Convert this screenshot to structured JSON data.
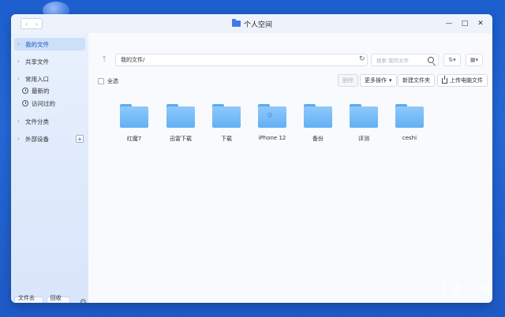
{
  "window": {
    "title": "个人空间",
    "controls": [
      "—",
      "□",
      "✕"
    ]
  },
  "sidebar": {
    "my_files": "我的文件",
    "shared_files": "共享文件",
    "common_entry": "常用入口",
    "recent": "最新的",
    "visited": "访问过的",
    "file_category": "文件分类",
    "external_devices": "外部设备",
    "file_transfer": "文件去重",
    "recycle_bin": "回收站"
  },
  "toolbar": {
    "path": "我的文件/",
    "search_placeholder": "搜索 我的文件",
    "select_all": "全选",
    "delete_label": "删除",
    "more_label": "更多操作",
    "new_folder_label": "新建文件夹",
    "upload_label": "上传电脑文件"
  },
  "folders": [
    {
      "name": "红魔7"
    },
    {
      "name": "迅雷下载"
    },
    {
      "name": "下载"
    },
    {
      "name": "iPhone 12"
    },
    {
      "name": "备份"
    },
    {
      "name": "评测"
    },
    {
      "name": "ceshi"
    }
  ],
  "watermark": {
    "main": "值",
    "line1": "新",
    "line2": "浪",
    "brand": "众测"
  }
}
